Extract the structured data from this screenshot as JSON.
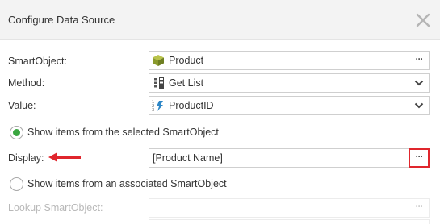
{
  "dialog": {
    "title": "Configure Data Source"
  },
  "form": {
    "smartobject": {
      "label": "SmartObject:",
      "value": "Product",
      "icon": "smartobject-cube-icon",
      "button": "···"
    },
    "method": {
      "label": "Method:",
      "value": "Get List",
      "icon": "list-method-icon"
    },
    "value_field": {
      "label": "Value:",
      "value": "ProductID",
      "icon": "autonumber-property-icon"
    },
    "option_selected": {
      "label": "Show items from the selected SmartObject",
      "selected": true
    },
    "display": {
      "label": "Display:",
      "value": "[Product Name]",
      "button": "···"
    },
    "option_associated": {
      "label": "Show items from an associated SmartObject",
      "selected": false
    },
    "lookup": {
      "label": "Lookup SmartObject:",
      "button": "···"
    }
  },
  "colors": {
    "radio_selected": "#3aa640",
    "annotation_red": "#e0262d",
    "titlebar_bg": "#f3f3f3",
    "disabled_text": "#b8b8b8"
  }
}
